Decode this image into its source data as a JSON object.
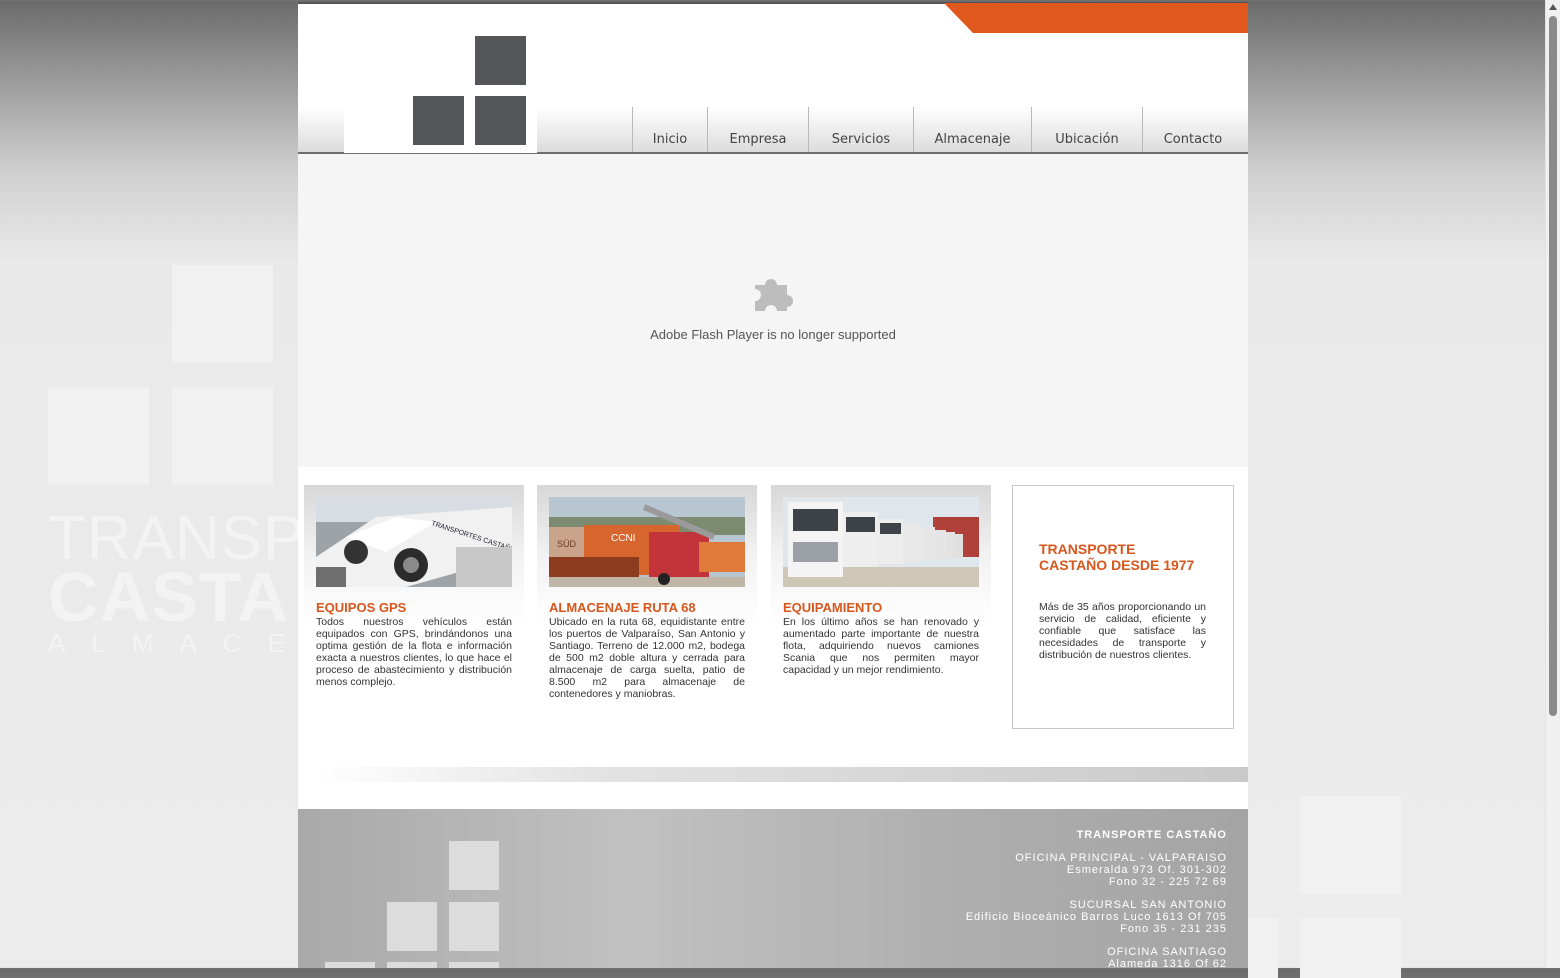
{
  "colors": {
    "accent": "#e0581d",
    "logo": "#55565a",
    "title": "#d9561c"
  },
  "background": {
    "line1": "TRANSPO",
    "line2": "CASTA",
    "line3": "ALMACEN"
  },
  "nav": {
    "items": [
      {
        "label": "Inicio"
      },
      {
        "label": "Empresa"
      },
      {
        "label": "Servicios"
      },
      {
        "label": "Almacenaje"
      },
      {
        "label": "Ubicación"
      },
      {
        "label": "Contacto"
      }
    ]
  },
  "flash": {
    "icon": "puzzle-piece-icon",
    "message": "Adobe Flash Player is no longer supported"
  },
  "cards": [
    {
      "title": "EQUIPOS GPS",
      "text": "Todos nuestros vehículos están equipados con GPS, brindándonos una optima gestión de la flota e información exacta a nuestros clientes, lo que hace el proceso de abastecimiento y distribución menos complejo.",
      "image_label": "TRANSPORTES CASTAÑO"
    },
    {
      "title": "ALMACENAJE RUTA 68",
      "text": "Ubicado en la ruta 68, equidistante entre los puertos de Valparaíso, San Antonio y Santiago. Terreno de 12.000 m2, bodega de 500 m2 doble altura y cerrada para almacenaje de carga suelta, patio de 8.500 m2 para almacenaje de contenedores y maniobras.",
      "image_label_1": "SÜD",
      "image_label_2": "CCNI"
    },
    {
      "title": "EQUIPAMIENTO",
      "text": "En los último años se han renovado y aumentado parte importante de nuestra flota, adquiriendo nuevos camiones Scania que nos permiten mayor capacidad y un mejor rendimiento."
    }
  ],
  "promo": {
    "title": "TRANSPORTE\nCASTAÑO DESDE 1977",
    "text": "Más de 35 años proporcionando un servicio de calidad, eficiente y confiable que satisface las necesidades de transporte y distribución de nuestros clientes."
  },
  "footer": {
    "company": "TRANSPORTE CASTAÑO",
    "offices": [
      {
        "name": "OFICINA PRINCIPAL - VALPARAISO",
        "address": "Esmeralda 973 Of. 301-302",
        "phone": "Fono 32 - 225 72 69"
      },
      {
        "name": "SUCURSAL SAN ANTONIO",
        "address": "Edificio Bioceánico Barros Luco 1613 Of 705",
        "phone": "Fono 35 - 231 235"
      },
      {
        "name": "OFICINA SANTIAGO",
        "address": "Alameda 1316 Of 62",
        "phone": ""
      }
    ]
  }
}
